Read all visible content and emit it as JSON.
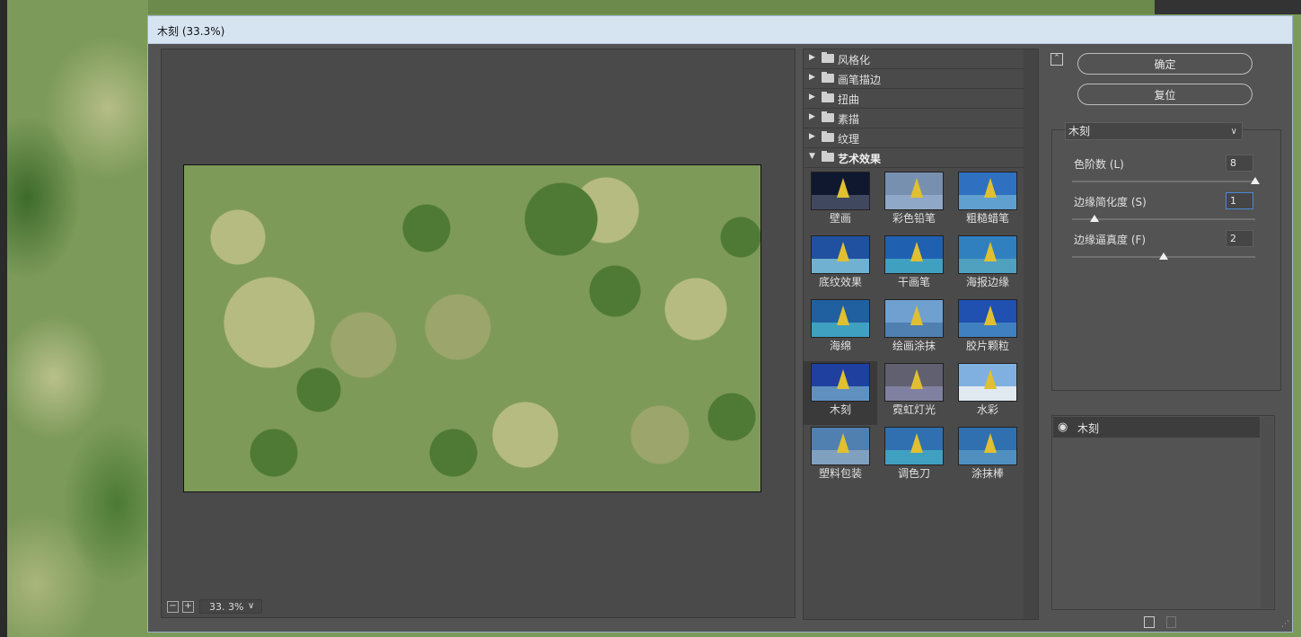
{
  "window": {
    "title": "木刻 (33.3%)"
  },
  "preview": {
    "zoom": "33. 3%",
    "zoom_out": "−",
    "zoom_in": "+",
    "zoom_dropdown": "∨"
  },
  "gallery": {
    "categories": [
      {
        "label": "风格化",
        "open": false
      },
      {
        "label": "画笔描边",
        "open": false
      },
      {
        "label": "扭曲",
        "open": false
      },
      {
        "label": "素描",
        "open": false
      },
      {
        "label": "纹理",
        "open": false
      },
      {
        "label": "艺术效果",
        "open": true
      }
    ],
    "filters": [
      {
        "label": "壁画"
      },
      {
        "label": "彩色铅笔"
      },
      {
        "label": "粗糙蜡笔"
      },
      {
        "label": "底纹效果"
      },
      {
        "label": "干画笔"
      },
      {
        "label": "海报边缘"
      },
      {
        "label": "海绵"
      },
      {
        "label": "绘画涂抹"
      },
      {
        "label": "胶片颗粒"
      },
      {
        "label": "木刻",
        "selected": true
      },
      {
        "label": "霓虹灯光"
      },
      {
        "label": "水彩"
      },
      {
        "label": "塑料包装"
      },
      {
        "label": "调色刀"
      },
      {
        "label": "涂抹棒"
      }
    ]
  },
  "controls": {
    "ok_label": "确定",
    "reset_label": "复位",
    "collapse_glyph": "⌃",
    "filter_select": {
      "value": "木刻",
      "chevron": "∨"
    },
    "params": [
      {
        "label": "色阶数 (L)",
        "value": "8",
        "level": 1.0
      },
      {
        "label": "边缘简化度 (S)",
        "value": "1",
        "level": 0.1
      },
      {
        "label": "边缘逼真度 (F)",
        "value": "2",
        "level": 0.5
      }
    ]
  },
  "layers": {
    "items": [
      {
        "name": "木刻",
        "visible": true
      }
    ],
    "eye_glyph": "◉"
  },
  "colors": {
    "dialog_bg": "#535353",
    "titlebar": "#d6e4f2",
    "accent_focus": "#4a8ad6"
  }
}
